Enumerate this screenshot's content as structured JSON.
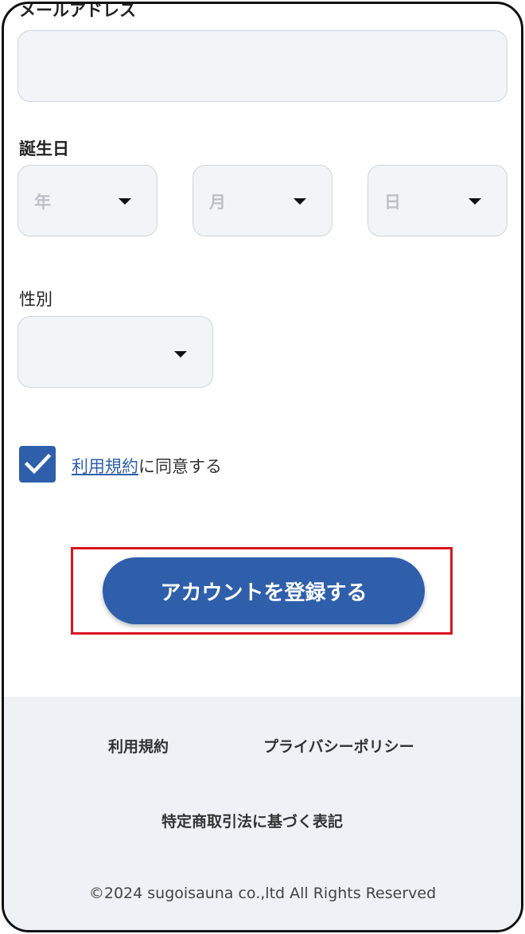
{
  "form": {
    "email_label": "メールアドレス",
    "email_value": "",
    "birthday_label": "誕生日",
    "year_placeholder": "年",
    "month_placeholder": "月",
    "day_placeholder": "日",
    "gender_label": "性別",
    "gender_value": "",
    "terms_checked": true,
    "terms_link": "利用規約",
    "terms_suffix": "に同意する",
    "submit_label": "アカウントを登録する"
  },
  "footer": {
    "terms": "利用規約",
    "privacy": "プライバシーポリシー",
    "commerce": "特定商取引法に基づく表記",
    "copyright": "©2024 sugoisauna co.,ltd All Rights Reserved"
  },
  "colors": {
    "accent": "#2f5fab",
    "highlight": "#d9141e",
    "footer_bg": "#eef1f6",
    "field_bg": "#f2f4f7"
  },
  "icons": {
    "checkbox": "checkmark-icon",
    "dropdown": "caret-down-icon"
  }
}
